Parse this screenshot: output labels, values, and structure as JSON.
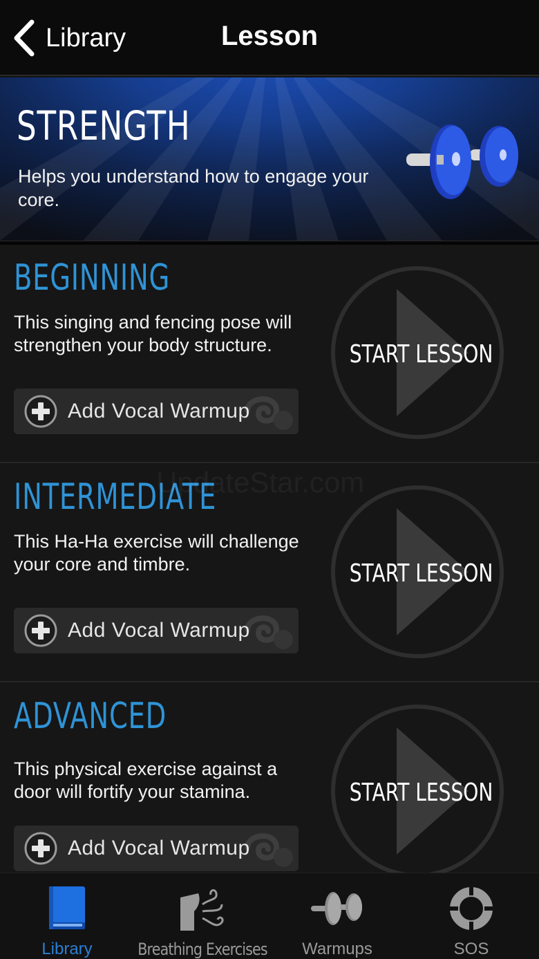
{
  "navbar": {
    "back_label": "Library",
    "title": "Lesson"
  },
  "hero": {
    "title": "STRENGTH",
    "description": "Helps you understand how to engage your core.",
    "icon": "dumbbell-icon"
  },
  "lessons": [
    {
      "title": "BEGINNING",
      "description": "This singing and fencing pose will strengthen your body structure.",
      "warmup_label": "Add Vocal Warmup",
      "start_label": "START LESSON"
    },
    {
      "title": "INTERMEDIATE",
      "description": "This Ha-Ha exercise will challenge your core and timbre.",
      "warmup_label": "Add Vocal Warmup",
      "start_label": "START LESSON"
    },
    {
      "title": "ADVANCED",
      "description": "This physical exercise against a door will fortify your stamina.",
      "warmup_label": "Add Vocal Warmup",
      "start_label": "START LESSON"
    }
  ],
  "watermark": "UpdateStar.com",
  "tabbar": {
    "tabs": [
      {
        "label": "Library",
        "icon": "book-icon",
        "active": true
      },
      {
        "label": "Breathing Exercises",
        "icon": "breathing-icon",
        "active": false
      },
      {
        "label": "Warmups",
        "icon": "dumbbell-icon",
        "active": false
      },
      {
        "label": "SOS",
        "icon": "lifebuoy-icon",
        "active": false
      }
    ]
  },
  "colors": {
    "accent_blue": "#2f93d6",
    "tab_active": "#2a7fd6",
    "hero_blue": "#1d4fb8",
    "background": "#161616"
  }
}
